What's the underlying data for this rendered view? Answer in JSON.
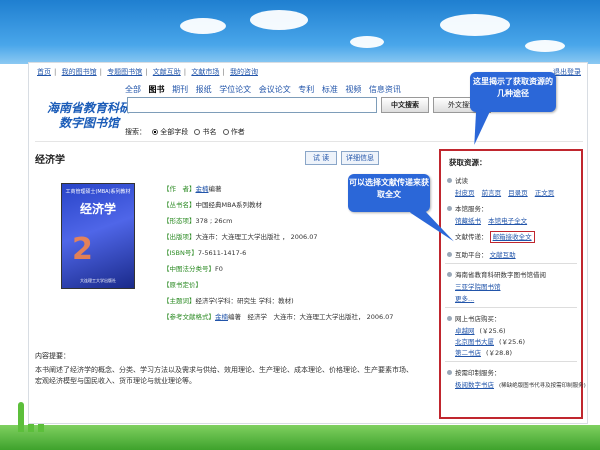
{
  "topnav": [
    "首页",
    "我的图书馆",
    "专题图书馆",
    "文献互助",
    "文献市场",
    "我的咨询"
  ],
  "top_right": "退出登录",
  "logo": [
    "海南省教育科研",
    "数字图书馆"
  ],
  "categories": [
    "全部",
    "图书",
    "期刊",
    "报纸",
    "学位论文",
    "会议论文",
    "专利",
    "标准",
    "视频",
    "信息资讯"
  ],
  "active_category": "图书",
  "search": {
    "value": "",
    "cn_button": "中文搜索",
    "en_button": "外文搜索"
  },
  "search_scope": {
    "label": "搜索：",
    "options": [
      "全部字段",
      "书名",
      "作者"
    ],
    "selected": "全部字段"
  },
  "book": {
    "title": "经济学",
    "trial_button": "试 读",
    "detail_button": "详细信息",
    "cover": {
      "series": "工商管理硕士(MBA)系列教材",
      "title": "经济学",
      "number": "2",
      "publisher": "大连理工大学出版社"
    },
    "metadata": [
      {
        "k": "【作　者】",
        "link": "金楠",
        "v": "编著"
      },
      {
        "k": "【丛书名】",
        "v": "中国经典MBA系列教材"
      },
      {
        "k": "【形态项】",
        "v": "378 ; 26cm"
      },
      {
        "k": "【出版项】",
        "v": "大连市：大连理工大学出版社 ， 2006.07"
      },
      {
        "k": "【ISBN号】",
        "v": "7-5611-1417-6"
      },
      {
        "k": "【中图法分类号】",
        "v": "F0"
      },
      {
        "k": "【原书定价】",
        "v": ""
      },
      {
        "k": "【主题词】",
        "v": "经济学(学科：研究生 学科：教材)"
      },
      {
        "k": "【参考文献格式】",
        "link": "金楠",
        "v": "编著　经济学　大连市：大连理工大学出版社， 2006.07"
      }
    ],
    "intro_heading": "内容提要：",
    "intro": "本书阐述了经济学的概念、分类、学习方法以及需求与供给、效用理论、生产理论、成本理论、价格理论、生产要素市场、宏观经济模型与国民收入、货币理论与就业理论等。"
  },
  "right_panel": {
    "title": "获取资源：",
    "trial_label": "试读",
    "trial_links": [
      "封皮页",
      "前言页",
      "目录页",
      "正文页"
    ],
    "local_label": "本馆服务：",
    "local_links": [
      "馆藏纸书",
      "本馆电子全文"
    ],
    "doc_delivery_label": "文献传递：",
    "doc_delivery_link": "邮箱接收全文",
    "mutual_label": "互助平台：",
    "mutual_link": "文献互助",
    "union_label": "海南省教育科研数字图书馆借阅",
    "union_links": [
      "三亚学院图书馆",
      "更多..."
    ],
    "buy_label": "网上书店购买：",
    "shops": [
      {
        "name": "卓越网",
        "price": "(￥25.6)"
      },
      {
        "name": "北京图书大厦",
        "price": "(￥25.6)"
      },
      {
        "name": "第二书店",
        "price": "(￥28.8)"
      }
    ],
    "print_label": "按需印制服务：",
    "print_link": "极阅数字书店",
    "print_note": "(稀缺绝版图书代寻及按需印制服务)"
  },
  "callouts": {
    "top": "这里揭示了获取资源的几种途径",
    "middle": "可以选择文献传递来获取全文"
  },
  "colors": {
    "accent": "#2b67d8",
    "highlight_border": "#c0262e",
    "link": "#2255aa",
    "label_green": "#2a8a22"
  }
}
